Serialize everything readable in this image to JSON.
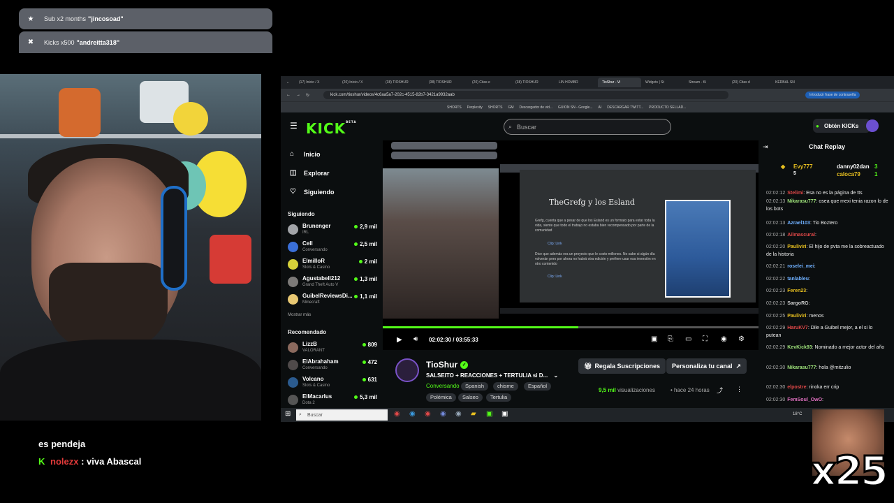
{
  "overlay": {
    "notifications": [
      {
        "icon": "star-icon",
        "text": "Sub x2 months",
        "user": "\"jincosoad\""
      },
      {
        "icon": "kick-icon",
        "text": "Kicks x500",
        "user": "\"andreitta318\""
      }
    ],
    "chat": [
      {
        "user": "",
        "text": "es pendeja"
      },
      {
        "user": "nolezx",
        "text": ": viva Abascal"
      }
    ],
    "multiplier": "x25"
  },
  "browser": {
    "tabs": [
      "(17) Inicio / X",
      "(20) Inicio / X",
      "(38) TIOSHUR",
      "(38) TIOSHUR",
      "(20) Citas e",
      "(38) TIOSHUR",
      "LIN HOMBR",
      "TioShur - Vi",
      "Widgets | St",
      "Stream - Ki",
      "(20) Citas d",
      "KERBAL SN"
    ],
    "url": "kick.com/tioshur/videos/4c6aa5a7-202c-4515-82b7-3421a9932aab",
    "password_button": "Introducir frase de contraseña",
    "bookmarks": [
      "SHORTS",
      "Perplexity",
      "SHORTS",
      "GM",
      "Descargador de vid...",
      "GUION SN - Google...",
      "AI",
      "DESCARGAR TWITT...",
      "PRODUCTO SELLAD..."
    ]
  },
  "kick": {
    "logo": "KICK",
    "logo_badge": "BETA",
    "search_placeholder": "Buscar",
    "get_kicks": "Obtén KICKs",
    "nav": [
      {
        "icon": "home-icon",
        "label": "Inicio"
      },
      {
        "icon": "compass-icon",
        "label": "Explorar"
      },
      {
        "icon": "heart-icon",
        "label": "Siguiendo"
      }
    ],
    "following_title": "Siguiendo",
    "following": [
      {
        "name": "Brunenger",
        "category": "IRL",
        "viewers": "2,9 mil",
        "color": "#a2a4a8"
      },
      {
        "name": "Cell",
        "category": "Conversando",
        "viewers": "2,5 mil",
        "color": "#3a6fd8"
      },
      {
        "name": "ElmilloR",
        "category": "Slots & Casino",
        "viewers": "2 mil",
        "color": "#d7d23a"
      },
      {
        "name": "Agustabell212",
        "category": "Grand Theft Auto V",
        "viewers": "1,3 mil",
        "color": "#7c7a78"
      },
      {
        "name": "GuibelReviewsDi...",
        "category": "Minecraft",
        "viewers": "1,1 mil",
        "color": "#e8c873"
      }
    ],
    "show_more": "Mostrar más",
    "recommended_title": "Recomendado",
    "recommended": [
      {
        "name": "LizzB",
        "category": "VALORANT",
        "viewers": "809",
        "color": "#8b6a5e"
      },
      {
        "name": "ElAbrahaham",
        "category": "Conversando",
        "viewers": "472",
        "color": "#4f4a4a"
      },
      {
        "name": "Volcano",
        "category": "Slots & Casino",
        "viewers": "631",
        "color": "#2b5b8f"
      },
      {
        "name": "ElMacarlus",
        "category": "Dota 2",
        "viewers": "5,3 mil",
        "color": "#555"
      }
    ],
    "player": {
      "time": "02:02:30 / 03:55:33",
      "progress": 0.52,
      "slide_title": "TheGrefg y los Esland",
      "slide_p1": "Grefg, cuenta que a pesar de que los Esland es un formato para estar toda la vida, siente que todo el trabajo no estaba bien recompensado por parte de la comunidad",
      "slide_clip1": "Clip: Link",
      "slide_p2": "Dice que además era un proyecto que le costo millones. No sabe si algún día volverán pero por ahora no habrá otra edición y prefiere usar esa inversión en otro contenido",
      "slide_clip2": "Clip: Link"
    },
    "channel": {
      "name": "TioShur",
      "title": "SALSEITO + REACCIONES + TERTULIA si D...",
      "category": "Conversando",
      "tags": [
        "Spanish",
        "chisme",
        "Español",
        "Polémica",
        "Salseo",
        "Tertulia"
      ],
      "subscribe_btn": "Regala Suscripciones",
      "customize_btn": "Personaliza tu canal",
      "views": "9,5 mil",
      "views_label": "visualizaciones",
      "ago": "hace 24 horas"
    },
    "chat": {
      "title": "Chat Replay",
      "pinned": [
        {
          "name": "Evy777",
          "count": "5"
        },
        {
          "name": "danny02dan",
          "count": "3"
        },
        {
          "name": "caloca79",
          "count": "1"
        }
      ],
      "messages": [
        {
          "time": "02:02:12",
          "user": "Stelimi",
          "color": "#e04848",
          "text": ": Esa no es la página de tts"
        },
        {
          "time": "02:02:13",
          "user": "Nikarasu777",
          "color": "#9ee27a",
          "text": ": osea que mexi tenia razon lo de los bots"
        },
        {
          "time": "02:02:13",
          "user": "Azrael103",
          "color": "#6fb0ff",
          "text": ": Tio Boztero"
        },
        {
          "time": "02:02:18",
          "user": "Ailmascural",
          "color": "#e04848",
          "text": ":"
        },
        {
          "time": "02:02:20",
          "user": "Pauliviri",
          "color": "#e8c020",
          "text": ": El hijo de pvta me la sobreactuado de la historia"
        },
        {
          "time": "02:02:21",
          "user": "roselei_mei",
          "color": "#6fb0ff",
          "text": ":"
        },
        {
          "time": "02:02:22",
          "user": "tanlableu",
          "color": "#6fb0ff",
          "text": ":"
        },
        {
          "time": "02:02:23",
          "user": "Feren23",
          "color": "#e8c020",
          "text": ":"
        },
        {
          "time": "02:02:23",
          "user": "SargoRG",
          "color": "#cccccc",
          "text": ":"
        },
        {
          "time": "02:02:25",
          "user": "Pauliviri",
          "color": "#e8c020",
          "text": ": menos"
        },
        {
          "time": "02:02:29",
          "user": "HaruKV7",
          "color": "#e04848",
          "text": ": Dile a Guibel mejor, a el si lo putean"
        },
        {
          "time": "02:02:29",
          "user": "KevKick93",
          "color": "#9ee27a",
          "text": ": Nominado a mejor actor del año"
        },
        {
          "time": "02:02:30",
          "user": "Nikarasu777",
          "color": "#9ee27a",
          "text": ": hola @mitzulio"
        },
        {
          "time": "02:02:30",
          "user": "elpostre",
          "color": "#e04848",
          "text": ": rinoka err crip"
        },
        {
          "time": "02:02:30",
          "user": "FemSoul_OwO",
          "color": "#e070c0",
          "text": ":"
        }
      ]
    },
    "taskbar_search": "Buscar",
    "weather": "18°C"
  }
}
